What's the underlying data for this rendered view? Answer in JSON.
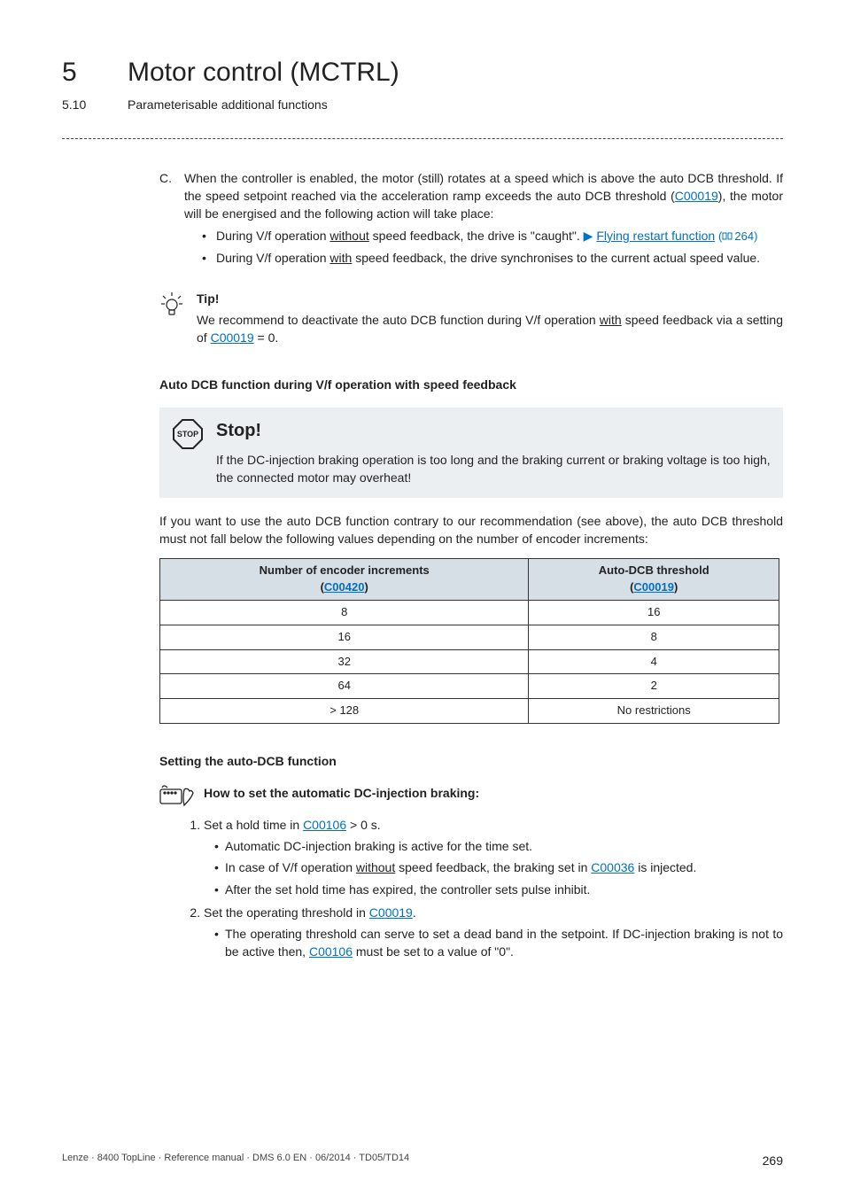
{
  "header": {
    "chapter_num": "5",
    "chapter_title": "Motor control (MCTRL)",
    "section_num": "5.10",
    "section_title": "Parameterisable additional functions"
  },
  "item_c": {
    "letter": "C.",
    "text": "When the controller is enabled, the motor (still) rotates at a speed which is above the auto DCB threshold. If the speed setpoint reached via the acceleration ramp exceeds the auto DCB threshold (",
    "link1": "C00019",
    "text_after": "), the motor will be energised and the following action will take place:",
    "bullet1": {
      "pre": "During V/f operation ",
      "u1": "without",
      "mid": " speed feedback, the drive is \"caught\". ",
      "arrow": "▶",
      "link": "Flying restart function",
      "pageref": "264"
    },
    "bullet2": {
      "pre": "During V/f operation ",
      "u1": "with",
      "post": " speed feedback, the drive synchronises to the current actual speed value."
    }
  },
  "tip": {
    "head": "Tip!",
    "body_pre": "We recommend to deactivate the auto DCB function during V/f operation ",
    "body_u": "with",
    "body_mid": " speed feedback via a setting of ",
    "body_link": "C00019",
    "body_post": " = 0."
  },
  "feedback_heading": "Auto DCB function during V/f operation with speed feedback",
  "stop": {
    "head": "Stop!",
    "body": "If the DC-injection braking operation is too long and the braking current or braking voltage is too high, the connected motor may overheat!"
  },
  "para_table_intro": "If you want to use the auto DCB function contrary to our recommendation (see above), the auto DCB threshold must not fall below the following values depending on the number of encoder increments:",
  "table": {
    "h1": "Number of encoder increments",
    "h1_link": "C00420",
    "h2": "Auto-DCB threshold",
    "h2_link": "C00019",
    "rows": [
      {
        "c1": "8",
        "c2": "16"
      },
      {
        "c1": "16",
        "c2": "8"
      },
      {
        "c1": "32",
        "c2": "4"
      },
      {
        "c1": "64",
        "c2": "2"
      },
      {
        "c1": "> 128",
        "c2": "No restrictions"
      }
    ]
  },
  "setting_heading": "Setting the auto-DCB function",
  "howto_head": "How to set the automatic DC-injection braking:",
  "steps": {
    "s1": {
      "pre": "Set a hold time in ",
      "link": "C00106",
      "post": " > 0 s.",
      "sub": [
        "Automatic DC-injection braking is active for the time set.",
        {
          "pre": "In case of V/f operation ",
          "u": "without",
          "mid": " speed feedback, the braking set in ",
          "link": "C00036",
          "post": " is injected."
        },
        "After the set hold time has expired, the controller sets pulse inhibit."
      ]
    },
    "s2": {
      "pre": "Set the operating threshold in ",
      "link": "C00019",
      "post": ".",
      "sub": {
        "pre": "The operating threshold can serve to set a dead band in the setpoint. If DC-injection braking is not to be active then, ",
        "link": "C00106",
        "post": " must be set to a value of \"0\"."
      }
    }
  },
  "footer": {
    "left": "Lenze · 8400 TopLine · Reference manual · DMS 6.0 EN · 06/2014 · TD05/TD14",
    "right": "269"
  }
}
